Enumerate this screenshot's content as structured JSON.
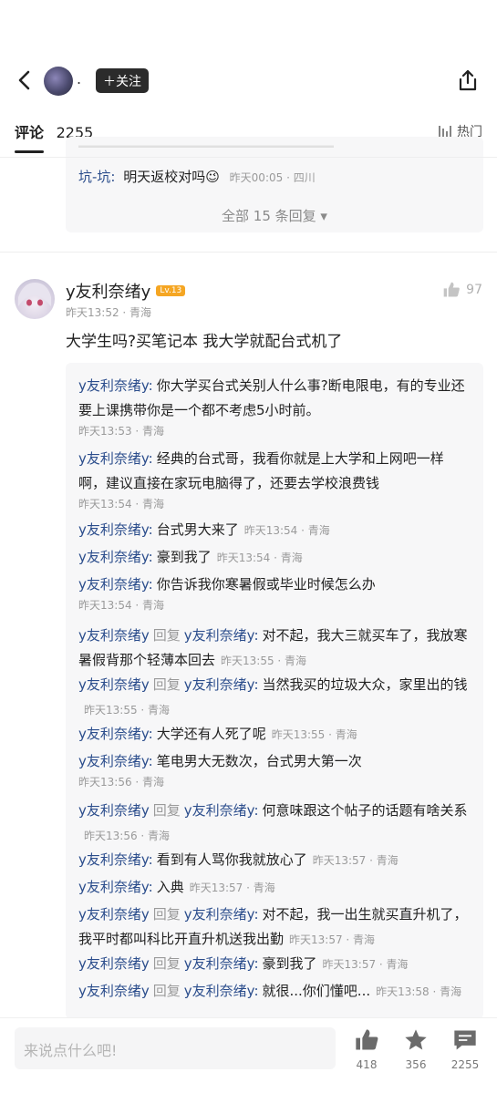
{
  "topbar": {
    "dot_name": ".",
    "follow_label": "＋关注"
  },
  "tabs": {
    "comments_label": "评论",
    "comments_count": "2255",
    "sort_label": "热门"
  },
  "prev_block": {
    "reply_name": "坑-坑:",
    "reply_text": "明天返校对吗😉",
    "reply_meta": "昨天00:05 · 四川",
    "all_replies": "全部 15 条回复 ▾"
  },
  "comment": {
    "author": "y友利奈绪y",
    "level": "Lv.13",
    "meta": "昨天13:52 · 青海",
    "likes": "97",
    "text": "大学生吗?买笔记本  我大学就配台式机了"
  },
  "replies": [
    {
      "name": "y友利奈绪y:",
      "text": "你大学买台式关别人什么事?断电限电，有的专业还要上课携带你是一个都不考虑5小时前。",
      "meta": "昨天13:53 · 青海"
    },
    {
      "name": "y友利奈绪y:",
      "text": "经典的台式哥，我看你就是上大学和上网吧一样啊，建议直接在家玩电脑得了，还要去学校浪费钱",
      "meta": "昨天13:54 · 青海"
    },
    {
      "name": "y友利奈绪y:",
      "text": "台式男大来了",
      "meta": "昨天13:54 · 青海"
    },
    {
      "name": "y友利奈绪y:",
      "text": "豪到我了",
      "meta": "昨天13:54 · 青海"
    },
    {
      "name": "y友利奈绪y:",
      "text": "你告诉我你寒暑假或毕业时候怎么办",
      "meta": "昨天13:54 · 青海"
    },
    {
      "name": "y友利奈绪y",
      "reply_label": "回复",
      "reply_to": "y友利奈绪y:",
      "text": "对不起，我大三就买车了，我放寒暑假背那个轻薄本回去",
      "meta": "昨天13:55 · 青海"
    },
    {
      "name": "y友利奈绪y",
      "reply_label": "回复",
      "reply_to": "y友利奈绪y:",
      "text": "当然我买的垃圾大众，家里出的钱",
      "meta": "昨天13:55 · 青海"
    },
    {
      "name": "y友利奈绪y:",
      "text": "大学还有人死了呢",
      "meta": "昨天13:55 · 青海"
    },
    {
      "name": "y友利奈绪y:",
      "text": "笔电男大无数次，台式男大第一次",
      "meta": "昨天13:56 · 青海"
    },
    {
      "name": "y友利奈绪y",
      "reply_label": "回复",
      "reply_to": "y友利奈绪y:",
      "text": "何意味跟这个帖子的话题有啥关系",
      "meta": "昨天13:56 · 青海"
    },
    {
      "name": "y友利奈绪y:",
      "text": "看到有人骂你我就放心了",
      "meta": "昨天13:57 · 青海"
    },
    {
      "name": "y友利奈绪y:",
      "text": "入典",
      "meta": "昨天13:57 · 青海"
    },
    {
      "name": "y友利奈绪y",
      "reply_label": "回复",
      "reply_to": "y友利奈绪y:",
      "text": "对不起，我一出生就买直升机了，我平时都叫科比开直升机送我出勤",
      "meta": "昨天13:57 · 青海"
    },
    {
      "name": "y友利奈绪y",
      "reply_label": "回复",
      "reply_to": "y友利奈绪y:",
      "text": "豪到我了",
      "meta": "昨天13:57 · 青海"
    },
    {
      "name": "y友利奈绪y",
      "reply_label": "回复",
      "reply_to": "y友利奈绪y:",
      "text": "就很...你们懂吧...",
      "meta": "昨天13:58 · 青海"
    }
  ],
  "bottombar": {
    "input_placeholder": "来说点什么吧!",
    "likes": "418",
    "stars": "356",
    "comments": "2255"
  },
  "colors": {
    "name_link": "#2b4d8c",
    "meta_gray": "#9a9a9a",
    "reply_bg": "#f7f7f8",
    "level_badge": "#f5a623"
  },
  "icons": [
    "back-arrow-icon",
    "share-icon",
    "sort-bars-icon",
    "thumb-up-icon",
    "star-icon",
    "comment-bubble-icon"
  ]
}
